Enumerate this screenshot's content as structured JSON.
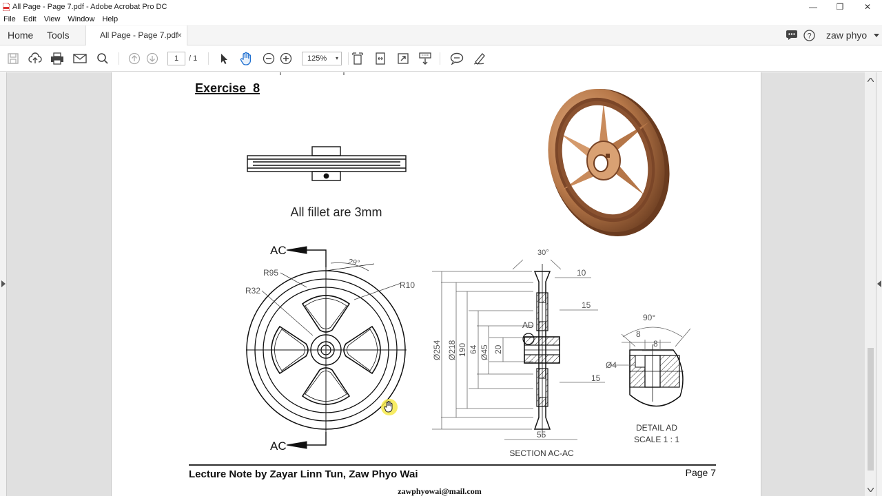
{
  "window": {
    "title": "All Page - Page 7.pdf - Adobe Acrobat Pro DC",
    "minimize": "—",
    "restore": "❐",
    "close": "✕"
  },
  "menu": [
    "File",
    "Edit",
    "View",
    "Window",
    "Help"
  ],
  "tabs": {
    "home": "Home",
    "tools": "Tools",
    "document": "All Page - Page 7.pdf",
    "close": "×"
  },
  "user": {
    "name": "zaw phyo"
  },
  "toolbar": {
    "page_current": "1",
    "page_total": "/ 1",
    "zoom": "125%",
    "zoom_caret": "▾"
  },
  "document": {
    "exercise_title": "Exercise_8",
    "fillet_note": "All fillet are 3mm",
    "section_label": "AC",
    "dims": {
      "angle_29": "29°",
      "r95": "R95",
      "r32": "R32",
      "r10": "R10",
      "angle_30": "30°",
      "d10": "10",
      "d15a": "15",
      "ad": "AD",
      "d254": "Ø254",
      "d218": "Ø218",
      "d190": "190",
      "d64": "64",
      "d45": "Ø45",
      "d20": "20",
      "d15b": "15",
      "d55": "55",
      "angle_90": "90°",
      "d8a": "8",
      "d8b": "8",
      "d4": "Ø4"
    },
    "section_caption": "SECTION AC-AC",
    "detail_caption": "DETAIL AD",
    "detail_scale": "SCALE 1 : 1",
    "footer_left": "Lecture Note by Zayar Linn Tun, Zaw Phyo Wai",
    "footer_right": "Page 7",
    "email": "zawphyowai@mail.com"
  },
  "colors": {
    "pulley": "#b4784a",
    "pulley_dark": "#7a4a2a",
    "pulley_light": "#e6b48a",
    "cursor_highlight": "#f6e94a"
  }
}
